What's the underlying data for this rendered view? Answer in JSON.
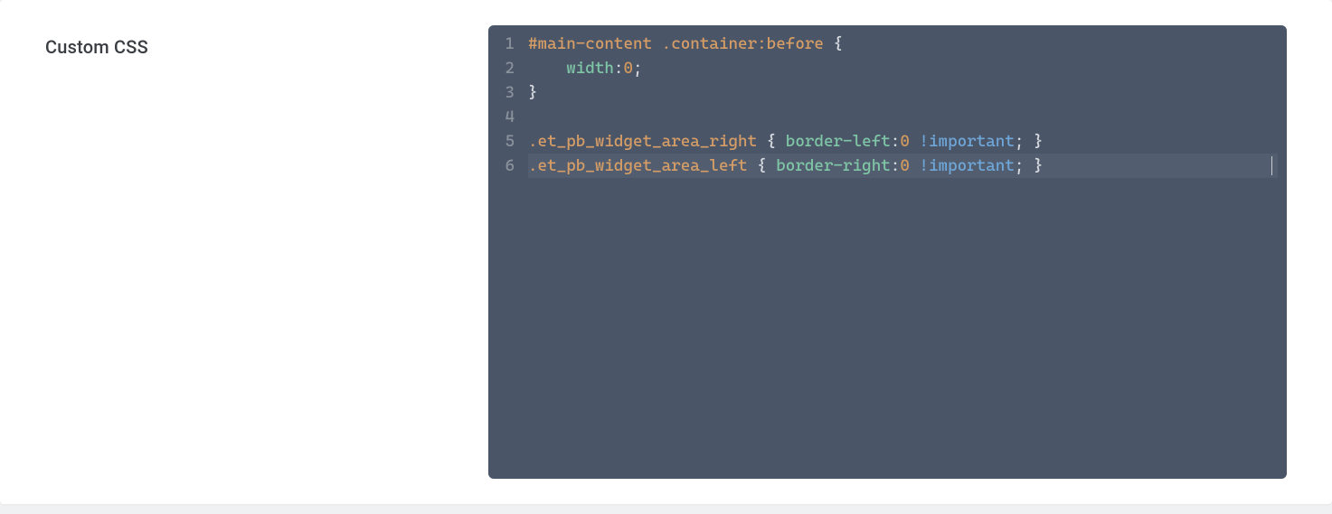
{
  "field_label": "Custom CSS",
  "code_lines": [
    {
      "num": "1",
      "tokens": [
        {
          "cls": "sel",
          "txt": "#main-content "
        },
        {
          "cls": "sel",
          "txt": ".container"
        },
        {
          "cls": "sel",
          "txt": ":before"
        },
        {
          "cls": "brace",
          "txt": " {"
        }
      ]
    },
    {
      "num": "2",
      "tokens": [
        {
          "cls": "brace",
          "txt": "    "
        },
        {
          "cls": "prop",
          "txt": "width"
        },
        {
          "cls": "brace",
          "txt": ":"
        },
        {
          "cls": "num",
          "txt": "0"
        },
        {
          "cls": "brace",
          "txt": ";"
        }
      ]
    },
    {
      "num": "3",
      "tokens": [
        {
          "cls": "brace",
          "txt": "}"
        }
      ]
    },
    {
      "num": "4",
      "tokens": []
    },
    {
      "num": "5",
      "tokens": [
        {
          "cls": "sel",
          "txt": ".et_pb_widget_area_right"
        },
        {
          "cls": "brace",
          "txt": " { "
        },
        {
          "cls": "prop",
          "txt": "border-left"
        },
        {
          "cls": "brace",
          "txt": ":"
        },
        {
          "cls": "num",
          "txt": "0"
        },
        {
          "cls": "brace",
          "txt": " "
        },
        {
          "cls": "imp",
          "txt": "!important"
        },
        {
          "cls": "brace",
          "txt": "; }"
        }
      ]
    },
    {
      "num": "6",
      "hl": true,
      "tokens": [
        {
          "cls": "sel",
          "txt": ".et_pb_widget_area_left"
        },
        {
          "cls": "brace",
          "txt": " { "
        },
        {
          "cls": "prop",
          "txt": "border-right"
        },
        {
          "cls": "brace",
          "txt": ":"
        },
        {
          "cls": "num",
          "txt": "0"
        },
        {
          "cls": "brace",
          "txt": " "
        },
        {
          "cls": "imp",
          "txt": "!important"
        },
        {
          "cls": "brace",
          "txt": "; }"
        }
      ]
    }
  ]
}
